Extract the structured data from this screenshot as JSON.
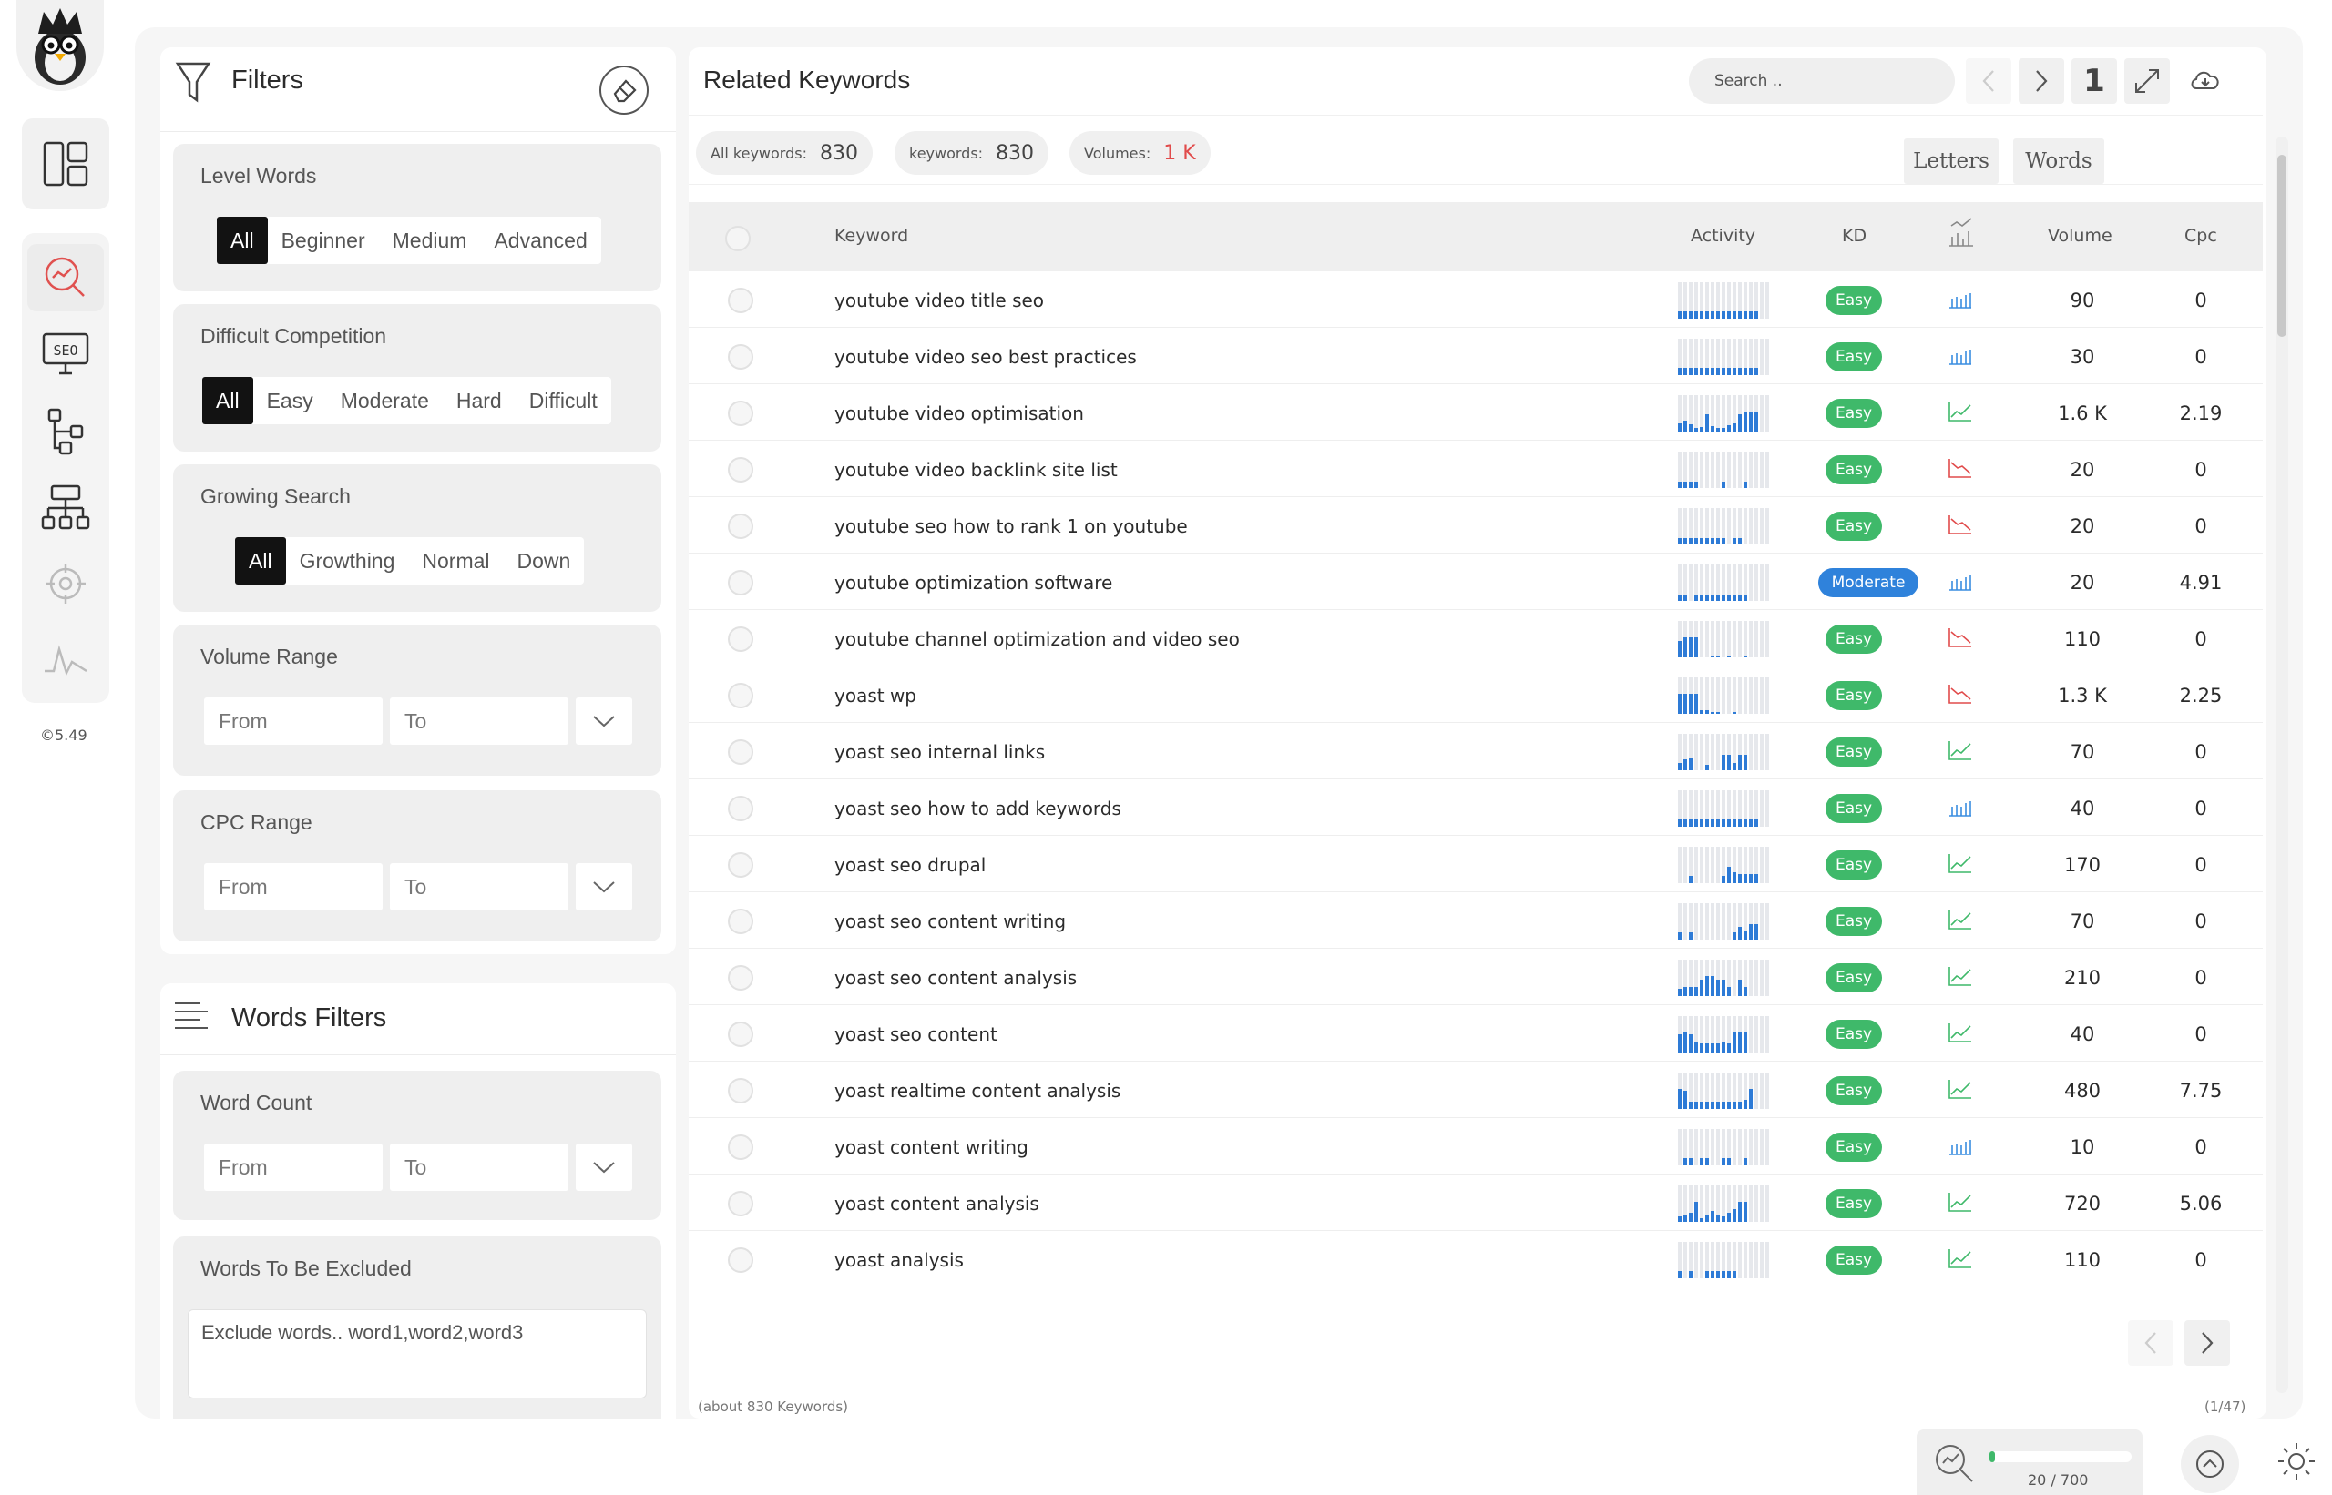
{
  "rail": {
    "version": "©5.49",
    "items": [
      "search-analysis-icon",
      "seo-monitor-icon",
      "flow-icon",
      "sitemap-icon",
      "target-icon",
      "pulse-icon"
    ]
  },
  "filters": {
    "title": "Filters",
    "level_words": {
      "title": "Level Words",
      "options": [
        "All",
        "Beginner",
        "Medium",
        "Advanced"
      ],
      "selected": "All"
    },
    "difficult_competition": {
      "title": "Difficult Competition",
      "options": [
        "All",
        "Easy",
        "Moderate",
        "Hard",
        "Difficult"
      ],
      "selected": "All"
    },
    "growing_search": {
      "title": "Growing Search",
      "options": [
        "All",
        "Growthing",
        "Normal",
        "Down"
      ],
      "selected": "All"
    },
    "volume_range": {
      "title": "Volume Range",
      "from": "From",
      "to": "To"
    },
    "cpc_range": {
      "title": "CPC Range",
      "from": "From",
      "to": "To"
    }
  },
  "words_filters": {
    "title": "Words Filters",
    "word_count": {
      "title": "Word Count",
      "from": "From",
      "to": "To"
    },
    "excluded": {
      "title": "Words To Be Excluded",
      "placeholder": "Exclude words.. word1,word2,word3"
    }
  },
  "main": {
    "title": "Related Keywords",
    "search_placeholder": "Search ..",
    "page_indicator": "1",
    "stats": [
      {
        "label": "All keywords:",
        "value": "830"
      },
      {
        "label": "keywords:",
        "value": "830"
      },
      {
        "label": "Volumes:",
        "value": "1 K"
      }
    ],
    "view_letters": "Letters",
    "view_words": "Words",
    "columns": {
      "keyword": "Keyword",
      "activity": "Activity",
      "kd": "KD",
      "volume": "Volume",
      "cpc": "Cpc"
    },
    "rows": [
      {
        "keyword": "youtube video title seo",
        "kd": "Easy",
        "trend": "bars",
        "volume": "90",
        "cpc": "0"
      },
      {
        "keyword": "youtube video seo best practices",
        "kd": "Easy",
        "trend": "bars",
        "volume": "30",
        "cpc": "0"
      },
      {
        "keyword": "youtube video optimisation",
        "kd": "Easy",
        "trend": "up",
        "volume": "1.6 K",
        "cpc": "2.19"
      },
      {
        "keyword": "youtube video backlink site list",
        "kd": "Easy",
        "trend": "down",
        "volume": "20",
        "cpc": "0"
      },
      {
        "keyword": "youtube seo how to rank 1 on youtube",
        "kd": "Easy",
        "trend": "down",
        "volume": "20",
        "cpc": "0"
      },
      {
        "keyword": "youtube optimization software",
        "kd": "Moderate",
        "trend": "bars",
        "volume": "20",
        "cpc": "4.91"
      },
      {
        "keyword": "youtube channel optimization and video seo",
        "kd": "Easy",
        "trend": "down",
        "volume": "110",
        "cpc": "0"
      },
      {
        "keyword": "yoast wp",
        "kd": "Easy",
        "trend": "down",
        "volume": "1.3 K",
        "cpc": "2.25"
      },
      {
        "keyword": "yoast seo internal links",
        "kd": "Easy",
        "trend": "up",
        "volume": "70",
        "cpc": "0"
      },
      {
        "keyword": "yoast seo how to add keywords",
        "kd": "Easy",
        "trend": "bars",
        "volume": "40",
        "cpc": "0"
      },
      {
        "keyword": "yoast seo drupal",
        "kd": "Easy",
        "trend": "up",
        "volume": "170",
        "cpc": "0"
      },
      {
        "keyword": "yoast seo content writing",
        "kd": "Easy",
        "trend": "up",
        "volume": "70",
        "cpc": "0"
      },
      {
        "keyword": "yoast seo content analysis",
        "kd": "Easy",
        "trend": "up",
        "volume": "210",
        "cpc": "0"
      },
      {
        "keyword": "yoast seo content",
        "kd": "Easy",
        "trend": "up",
        "volume": "40",
        "cpc": "0"
      },
      {
        "keyword": "yoast realtime content analysis",
        "kd": "Easy",
        "trend": "up",
        "volume": "480",
        "cpc": "7.75"
      },
      {
        "keyword": "yoast content writing",
        "kd": "Easy",
        "trend": "bars",
        "volume": "10",
        "cpc": "0"
      },
      {
        "keyword": "yoast content analysis",
        "kd": "Easy",
        "trend": "up",
        "volume": "720",
        "cpc": "5.06"
      },
      {
        "keyword": "yoast analysis",
        "kd": "Easy",
        "trend": "up",
        "volume": "110",
        "cpc": "0"
      }
    ],
    "footer_count": "(about 830 Keywords)",
    "footer_pages": "(1/47)"
  },
  "quota": {
    "text": "20 / 700",
    "used": 20,
    "total": 700
  },
  "colors": {
    "easy": "#3fb96a",
    "moderate": "#2f82db",
    "activity": "#2e7bd6",
    "accent": "#e14b4b"
  }
}
